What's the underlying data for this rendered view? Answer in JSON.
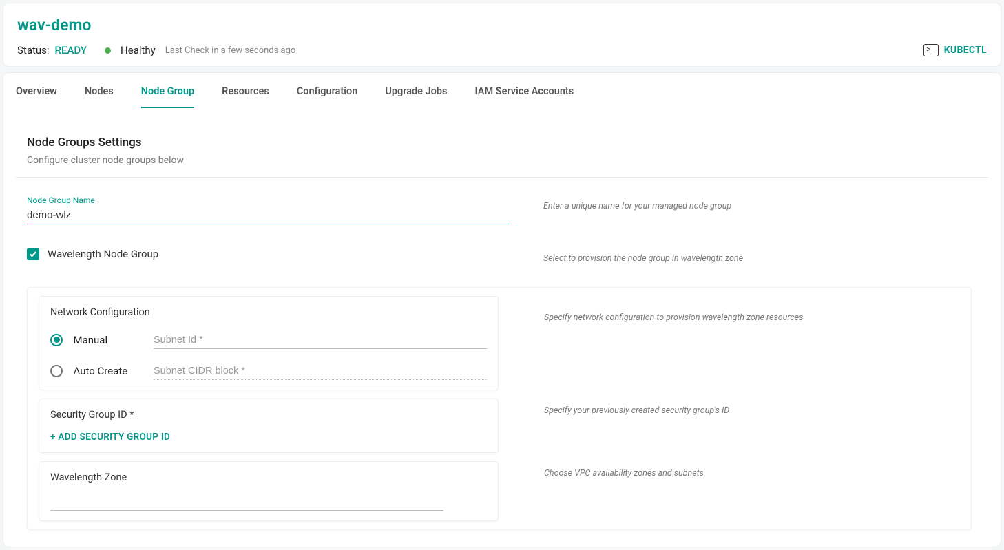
{
  "header": {
    "title": "wav-demo",
    "status_label": "Status:",
    "status_value": "READY",
    "health": "Healthy",
    "last_check": "Last Check in a few seconds ago",
    "kubectl_label": "KUBECTL",
    "kubectl_icon_glyph": ">_"
  },
  "tabs": [
    {
      "label": "Overview",
      "active": false
    },
    {
      "label": "Nodes",
      "active": false
    },
    {
      "label": "Node Group",
      "active": true
    },
    {
      "label": "Resources",
      "active": false
    },
    {
      "label": "Configuration",
      "active": false
    },
    {
      "label": "Upgrade Jobs",
      "active": false
    },
    {
      "label": "IAM Service Accounts",
      "active": false
    }
  ],
  "settings": {
    "title": "Node Groups Settings",
    "subtitle": "Configure cluster node groups below"
  },
  "node_group_name": {
    "label": "Node Group Name",
    "value": "demo-wlz",
    "help": "Enter a unique name for your managed node group"
  },
  "wavelength": {
    "label": "Wavelength Node Group",
    "checked": true,
    "help": "Select to provision the node group in wavelength zone"
  },
  "network_config": {
    "title": "Network Configuration",
    "help": "Specify network configuration to provision wavelength zone resources",
    "manual_label": "Manual",
    "auto_label": "Auto Create",
    "subnet_id_placeholder": "Subnet Id *",
    "subnet_cidr_placeholder": "Subnet CIDR block *",
    "selected": "manual"
  },
  "security_group": {
    "title": "Security Group ID *",
    "add_label": "+ ADD  SECURITY GROUP ID",
    "help": "Specify your previously created security group's ID"
  },
  "wavelength_zone": {
    "title": "Wavelength Zone",
    "help": "Choose VPC availability zones and subnets"
  }
}
